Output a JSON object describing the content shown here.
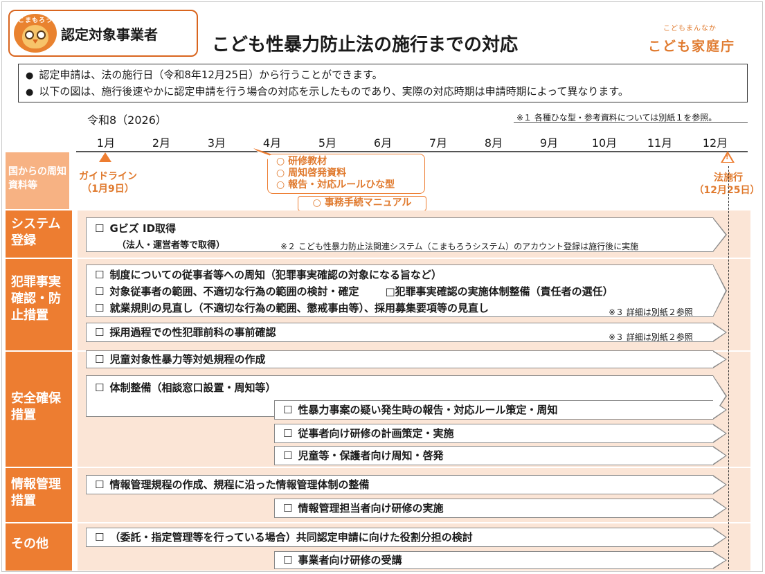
{
  "header": {
    "mascot_name": "こまもろう",
    "badge_title": "認定対象事業者",
    "main_title": "こども性暴力防止法の施行までの対応",
    "agency_sub": "こどもまんなか",
    "agency_name": "こども家庭庁"
  },
  "notes": [
    "認定申請は、法の施行日（令和8年12月25日）から行うことができます。",
    "以下の図は、施行後速やかに認定申請を行う場合の対応を示したものであり、実際の対応時期は申請時期によって異なります。"
  ],
  "timeline": {
    "year_label": "令和8（2026）",
    "ref_note": "※１ 各種ひな型・参考資料については別紙１を参照。",
    "months": [
      "1月",
      "2月",
      "3月",
      "4月",
      "5月",
      "6月",
      "7月",
      "8月",
      "9月",
      "10月",
      "11月",
      "12月"
    ]
  },
  "government": {
    "category": "国からの周知資料等",
    "guideline_label": "ガイドライン",
    "guideline_date": "（1月9日）",
    "callout_items": [
      "○ 研修教材",
      "○ 周知啓発資料",
      "○ 報告・対応ルールひな型"
    ],
    "manual_label": "○ 事務手続マニュアル",
    "enforcement_label": "法施行",
    "enforcement_date": "（12月25日）"
  },
  "categories": {
    "system": "システム登録",
    "crime": "犯罪事実確認・防止措置",
    "safety": "安全確保措置",
    "info": "情報管理措置",
    "other": "その他"
  },
  "tasks": {
    "gbiz": "Gビズ ID取得",
    "gbiz_sub": "（法人・運営者等で取得）",
    "gbiz_note": "※２ こども性暴力防止法関連システム（こまもろうシステム）のアカウント登録は施行後に実施",
    "crime1": "制度についての従事者等への周知（犯罪事実確認の対象になる旨など）",
    "crime2": "対象従事者の範囲、不適切な行為の範囲の検討・確定",
    "crime2b": "□犯罪事実確認の実施体制整備（責任者の選任）",
    "crime3": "就業規則の見直し（不適切な行為の範囲、懲戒事由等）、採用募集要項等の見直し",
    "crime3_note": "※３ 詳細は別紙２参照",
    "crime4": "採用過程での性犯罪前科の事前確認",
    "crime4_note": "※３ 詳細は別紙２参照",
    "safety1": "児童対象性暴力等対処規程の作成",
    "safety2": "体制整備（相談窓口設置・周知等）",
    "safety3": "性暴力事案の疑い発生時の報告・対応ルール策定・周知",
    "safety4": "従事者向け研修の計画策定・実施",
    "safety5": "児童等・保護者向け周知・啓発",
    "info1": "情報管理規程の作成、規程に沿った情報管理体制の整備",
    "info2": "情報管理担当者向け研修の実施",
    "other1": "（委託・指定管理等を行っている場合）共同認定申請に向けた役割分担の検討",
    "other2": "事業者向け研修の受講"
  },
  "checkbox": "☐",
  "bullet": "●",
  "colors": {
    "accent": "#ed7d31",
    "accent_light": "#f7b283",
    "band": "#fbe5d6"
  }
}
